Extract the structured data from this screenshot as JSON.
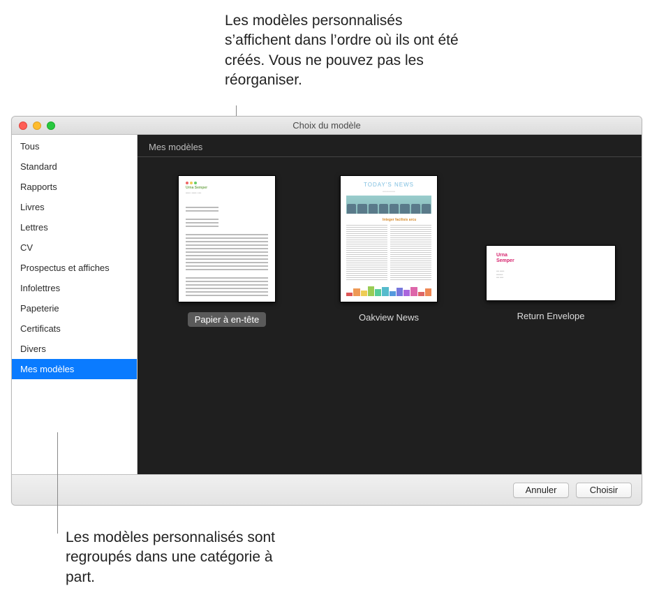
{
  "callouts": {
    "top": "Les modèles personnalisés s’affichent dans l’ordre où ils ont été créés. Vous ne pouvez pas les réorganiser.",
    "bottom": "Les modèles personnalisés sont regroupés dans une catégorie à part."
  },
  "window": {
    "title": "Choix du modèle"
  },
  "sidebar": {
    "items": [
      {
        "label": "Tous"
      },
      {
        "label": "Standard"
      },
      {
        "label": "Rapports"
      },
      {
        "label": "Livres"
      },
      {
        "label": "Lettres"
      },
      {
        "label": "CV"
      },
      {
        "label": "Prospectus et affiches"
      },
      {
        "label": "Infolettres"
      },
      {
        "label": "Papeterie"
      },
      {
        "label": "Certificats"
      },
      {
        "label": "Divers"
      },
      {
        "label": "Mes modèles"
      }
    ],
    "selected_index": 11
  },
  "content": {
    "section_header": "Mes modèles",
    "templates": [
      {
        "label": "Papier à en-tête",
        "selected": true
      },
      {
        "label": "Oakview News",
        "selected": false
      },
      {
        "label": "Return Envelope",
        "selected": false
      }
    ]
  },
  "footer": {
    "cancel": "Annuler",
    "choose": "Choisir"
  }
}
